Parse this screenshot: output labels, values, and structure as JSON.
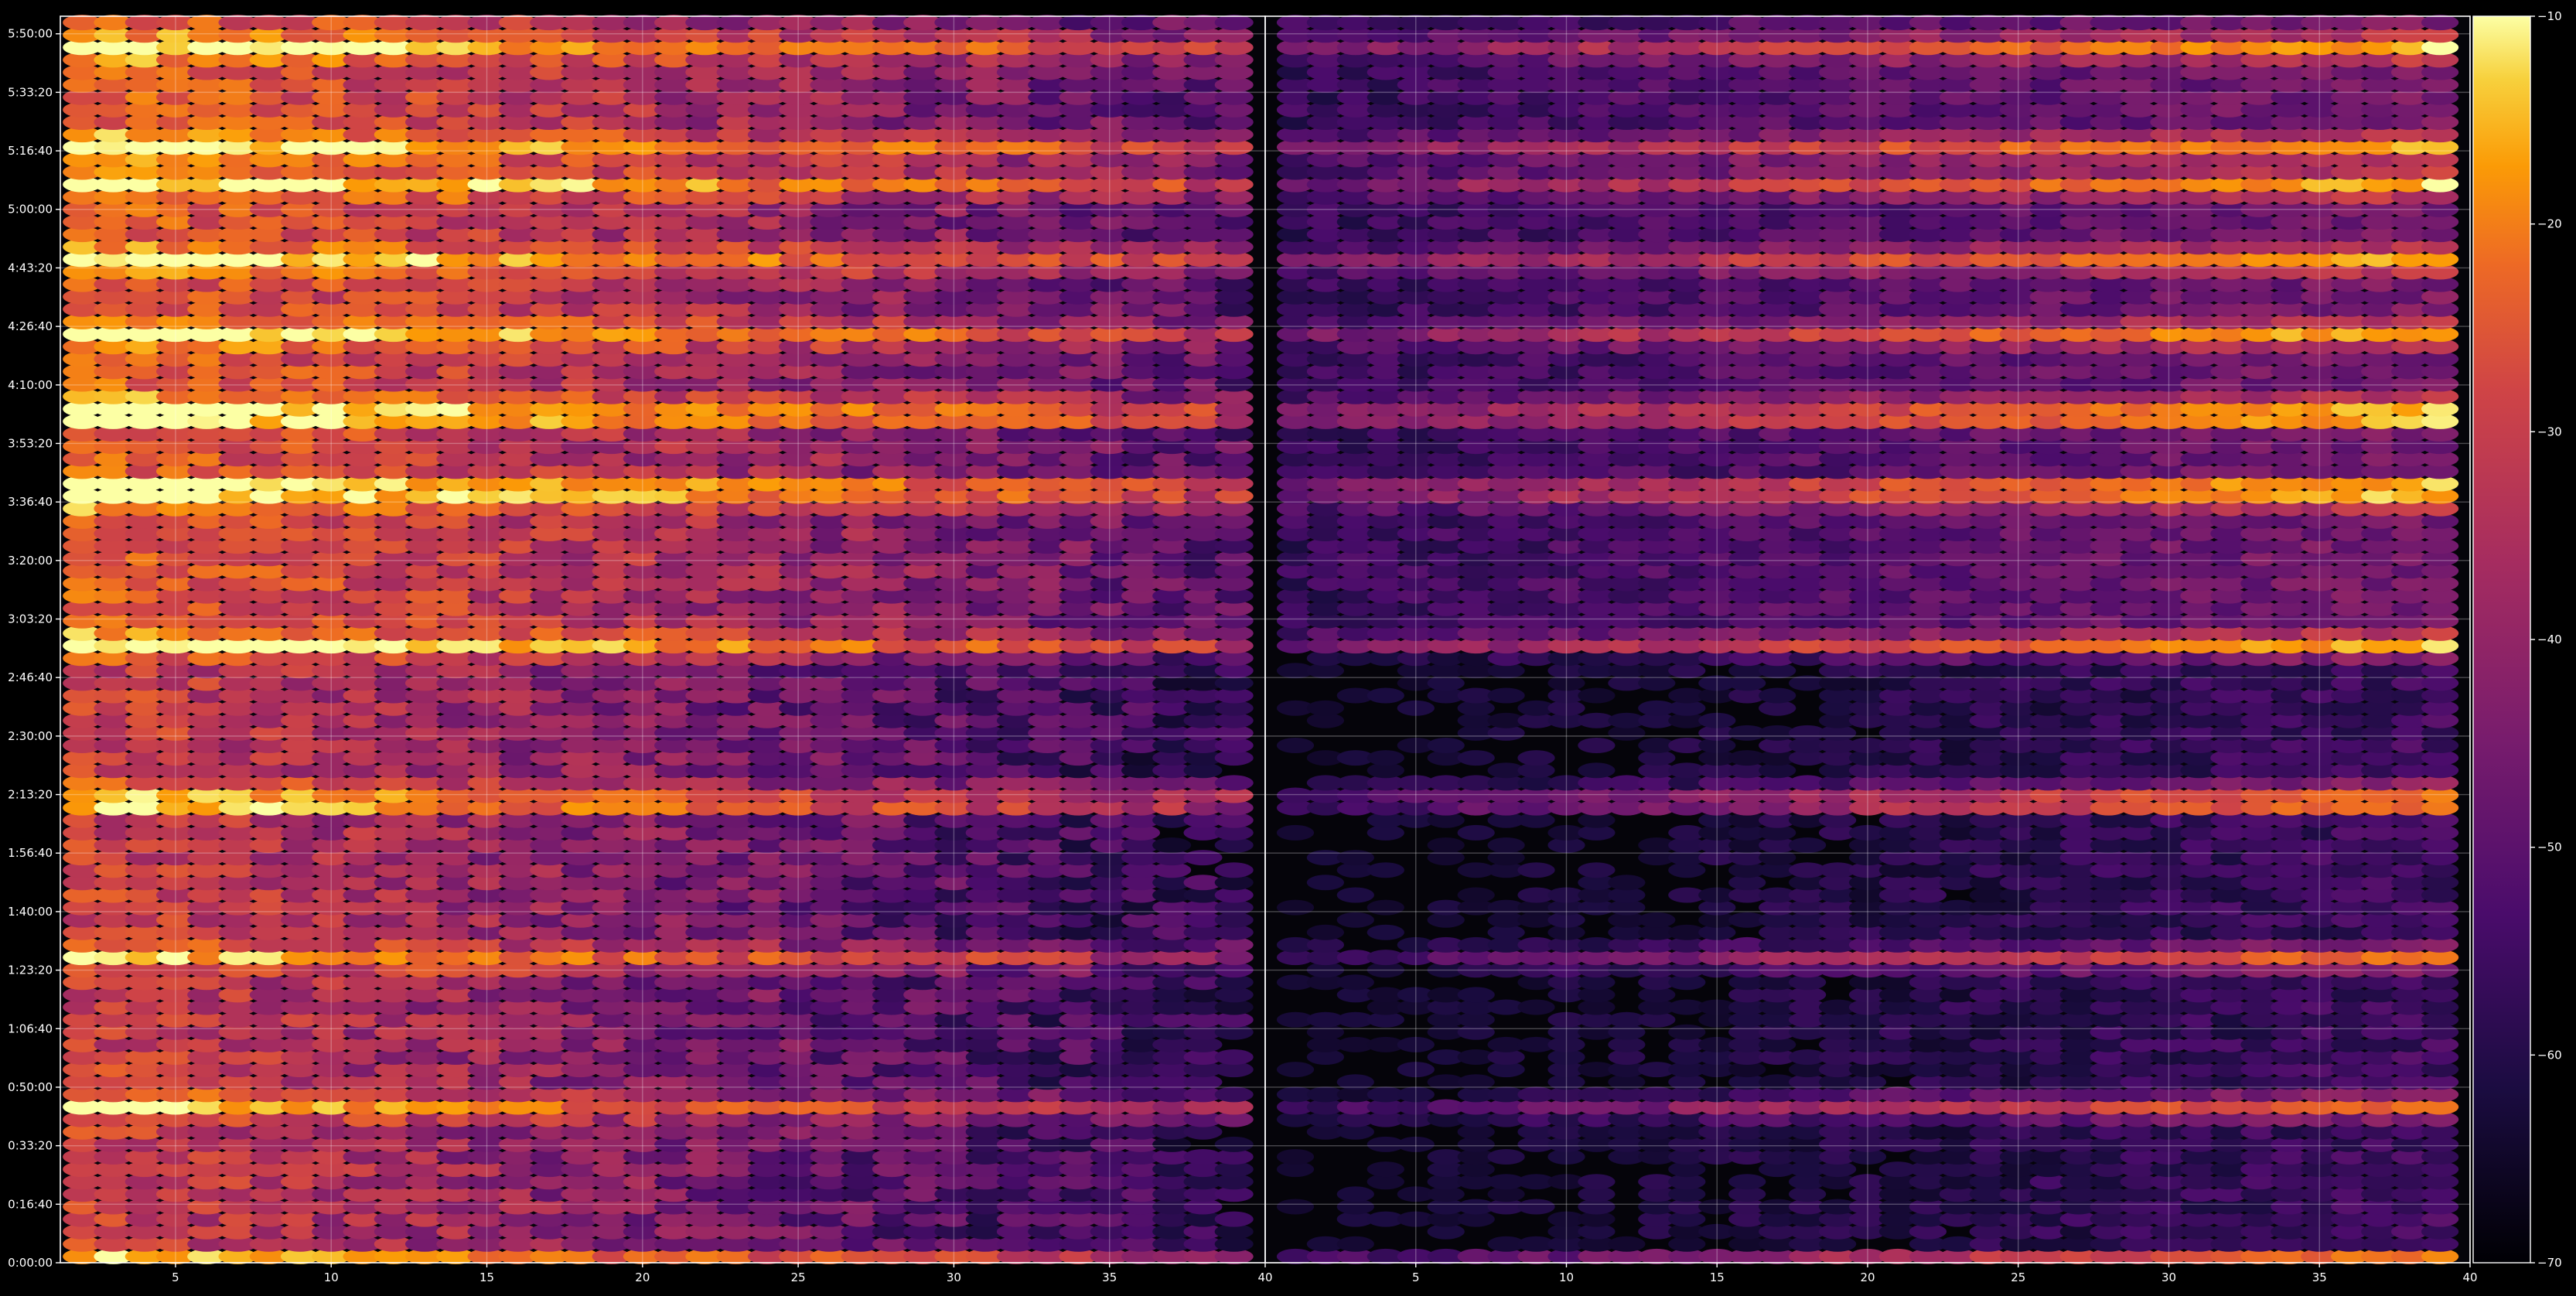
{
  "chart_data": {
    "type": "heatmap",
    "title": "",
    "colormap": "inferno",
    "background_color": "#000000",
    "axis_color": "#ffffff",
    "grid": true,
    "panels": [
      {
        "name": "left",
        "xlim": [
          1.3,
          40
        ],
        "x_ticks": [
          5,
          10,
          15,
          20,
          25,
          30,
          35,
          40
        ],
        "x_tick_labels": [
          "5",
          "10",
          "15",
          "20",
          "25",
          "30",
          "35",
          "40"
        ],
        "x_bin_count": 38,
        "x_first_bin": 2,
        "intensity_profile": "strong, fading toward high x"
      },
      {
        "name": "right",
        "xlim": [
          0,
          40
        ],
        "x_ticks": [
          5,
          10,
          15,
          20,
          25,
          30,
          35,
          40
        ],
        "x_tick_labels": [
          "5",
          "10",
          "15",
          "20",
          "25",
          "30",
          "35",
          "40"
        ],
        "x_bin_count": 39,
        "x_first_bin": 1,
        "intensity_profile": "weak, rising toward high x"
      }
    ],
    "ylim_seconds": [
      0,
      21300
    ],
    "y_ticks_seconds": [
      0,
      1000,
      2000,
      3000,
      4000,
      5000,
      6000,
      7000,
      8000,
      9000,
      10000,
      11000,
      12000,
      13000,
      14000,
      15000,
      16000,
      17000,
      18000,
      19000,
      20000,
      21000
    ],
    "y_tick_labels": [
      "0:00:00",
      "0:16:40",
      "0:33:20",
      "0:50:00",
      "1:06:40",
      "1:23:20",
      "1:40:00",
      "1:56:40",
      "2:13:20",
      "2:30:00",
      "2:46:40",
      "3:03:20",
      "3:20:00",
      "3:36:40",
      "3:53:20",
      "4:10:00",
      "4:26:40",
      "4:43:20",
      "5:00:00",
      "5:16:40",
      "5:33:20",
      "5:50:00"
    ],
    "y_row_count": 100,
    "strong_rows_seconds": [
      0,
      2600,
      5300,
      7900,
      10550,
      13200,
      14500,
      15850,
      17100,
      18450,
      19100,
      20800
    ],
    "colorbar": {
      "vmin": -70,
      "vmax": -10,
      "ticks": [
        -10,
        -20,
        -30,
        -40,
        -50,
        -60,
        -70
      ],
      "tick_labels": [
        "−10",
        "−20",
        "−30",
        "−40",
        "−50",
        "−60",
        "−70"
      ]
    }
  }
}
